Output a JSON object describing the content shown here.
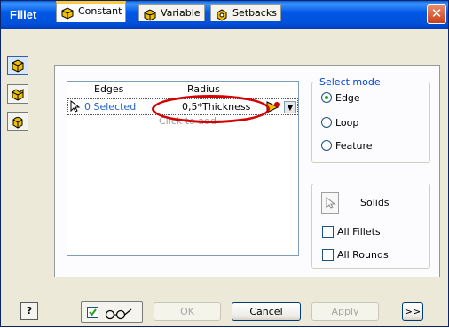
{
  "window": {
    "title": "Fillet",
    "close_glyph": "✕"
  },
  "sidebar": {
    "buttons": [
      {
        "name": "edge-fillet",
        "icon": "edge-fillet-icon",
        "active": true
      },
      {
        "name": "face-fillet",
        "icon": "face-fillet-icon",
        "active": false
      },
      {
        "name": "full-round-fillet",
        "icon": "full-round-fillet-icon",
        "active": false
      }
    ]
  },
  "tabs": [
    {
      "label": "Constant",
      "icon": "constant-fillet-icon",
      "active": true
    },
    {
      "label": "Variable",
      "icon": "variable-fillet-icon",
      "active": false
    },
    {
      "label": "Setbacks",
      "icon": "setbacks-icon",
      "active": false
    }
  ],
  "grid": {
    "columns": [
      "Edges",
      "Radius"
    ],
    "rows": [
      {
        "edges": "0 Selected",
        "radius": "0,5*Thickness"
      }
    ],
    "click_to_add": "Click to add"
  },
  "select_mode": {
    "title": "Select mode",
    "options": [
      {
        "label": "Edge",
        "selected": true
      },
      {
        "label": "Loop",
        "selected": false
      },
      {
        "label": "Feature",
        "selected": false
      }
    ]
  },
  "solids": {
    "label": "Solids"
  },
  "checks": [
    {
      "label": "All Fillets",
      "checked": false
    },
    {
      "label": "All Rounds",
      "checked": false
    }
  ],
  "footer": {
    "help": "?",
    "preview_checked": true,
    "ok": "OK",
    "cancel": "Cancel",
    "apply": "Apply",
    "more": ">>"
  },
  "colors": {
    "accent": "#0058e6",
    "highlight": "#d40000",
    "tab_active": "#ffc83c"
  }
}
